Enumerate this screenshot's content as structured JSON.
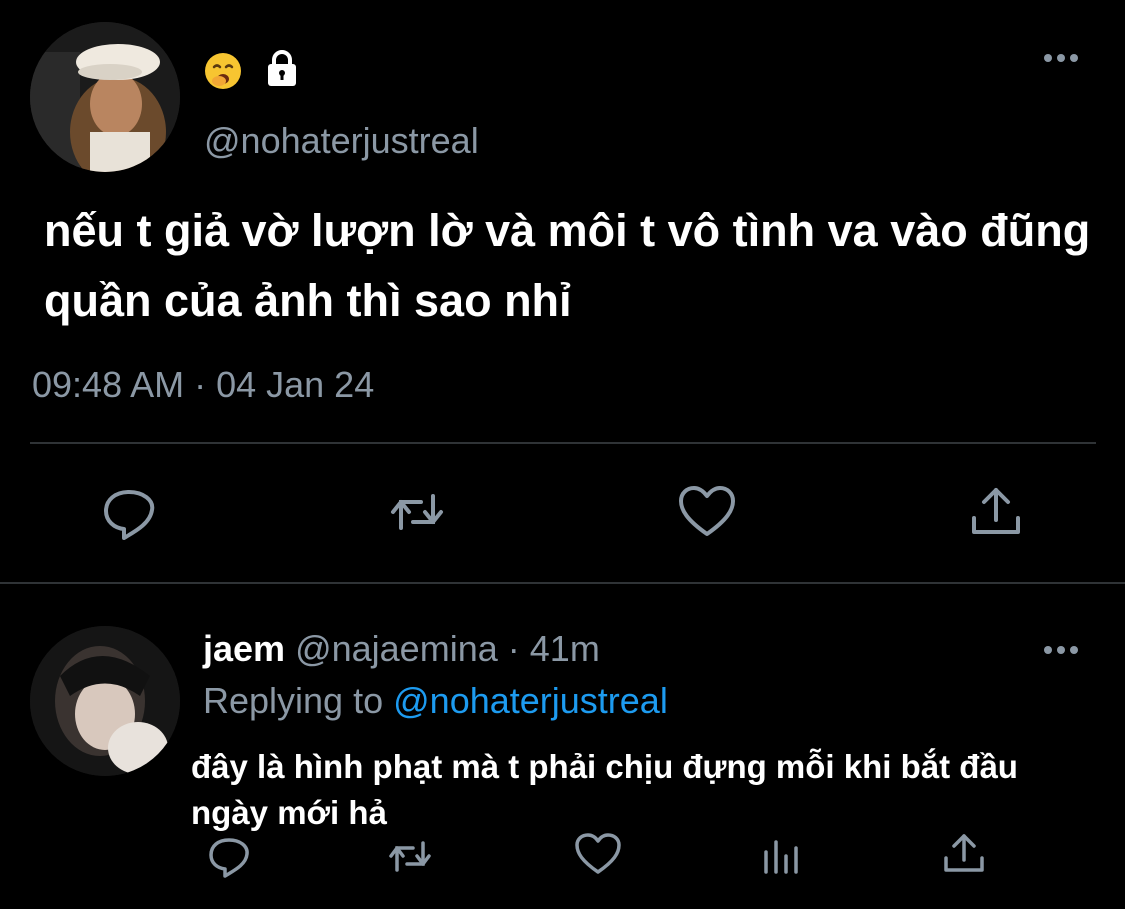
{
  "tweet": {
    "handle": "@nohaterjustreal",
    "text": "nếu t giả vờ lượn lờ và môi t vô tình va vào đũng quần của ảnh thì sao nhỉ",
    "timestamp": "09:48 AM · 04 Jan 24",
    "emoji_icon": "yawning-face-emoji",
    "lock_icon": "lock-icon"
  },
  "reply": {
    "name": "jaem",
    "handle": "@najaemina",
    "separator": "·",
    "time": "41m",
    "replying_prefix": "Replying to",
    "replying_to": "@nohaterjustreal",
    "text": "đây là hình phạt mà t phải chịu đựng mỗi khi bắt đầu ngày mới hả"
  },
  "colors": {
    "background": "#000000",
    "text_primary": "#ffffff",
    "text_secondary": "#8b98a5",
    "link": "#1d9bf0",
    "divider": "#2f3336"
  }
}
